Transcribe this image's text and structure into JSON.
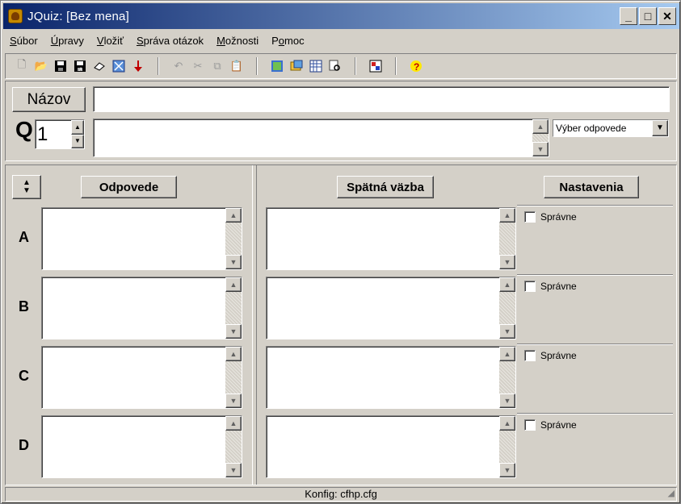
{
  "window": {
    "title": "JQuiz: [Bez mena]"
  },
  "menu": [
    {
      "pre": "",
      "u": "S",
      "post": "úbor"
    },
    {
      "pre": "",
      "u": "Ú",
      "post": "pravy"
    },
    {
      "pre": "",
      "u": "V",
      "post": "ložiť"
    },
    {
      "pre": "",
      "u": "S",
      "post": "práva otázok"
    },
    {
      "pre": "",
      "u": "M",
      "post": "ožnosti"
    },
    {
      "pre": "P",
      "u": "o",
      "post": "moc"
    }
  ],
  "header": {
    "nazov_label": "Názov",
    "nazov_value": "",
    "q_label": "Q",
    "question_number": "1",
    "question_text": "",
    "question_type": "Výber odpovede"
  },
  "columns": {
    "answers_label": "Odpovede",
    "feedback_label": "Spätná väzba",
    "settings_label": "Nastavenia"
  },
  "rows": [
    {
      "letter": "A",
      "answer": "",
      "feedback": "",
      "correct_label": "Správne"
    },
    {
      "letter": "B",
      "answer": "",
      "feedback": "",
      "correct_label": "Správne"
    },
    {
      "letter": "C",
      "answer": "",
      "feedback": "",
      "correct_label": "Správne"
    },
    {
      "letter": "D",
      "answer": "",
      "feedback": "",
      "correct_label": "Správne"
    }
  ],
  "status": {
    "text": "Konfig: cfhp.cfg"
  },
  "icons": {
    "toolbar": [
      "new-icon",
      "open-icon",
      "save-icon",
      "save-as-icon",
      "eraser-icon",
      "web-export-icon",
      "down-arrow-icon",
      "undo-icon",
      "cut-icon",
      "copy-icon",
      "paste-icon",
      "add-question-icon",
      "image-icon",
      "grid-icon",
      "find-icon",
      "config-icon",
      "help-icon"
    ]
  }
}
